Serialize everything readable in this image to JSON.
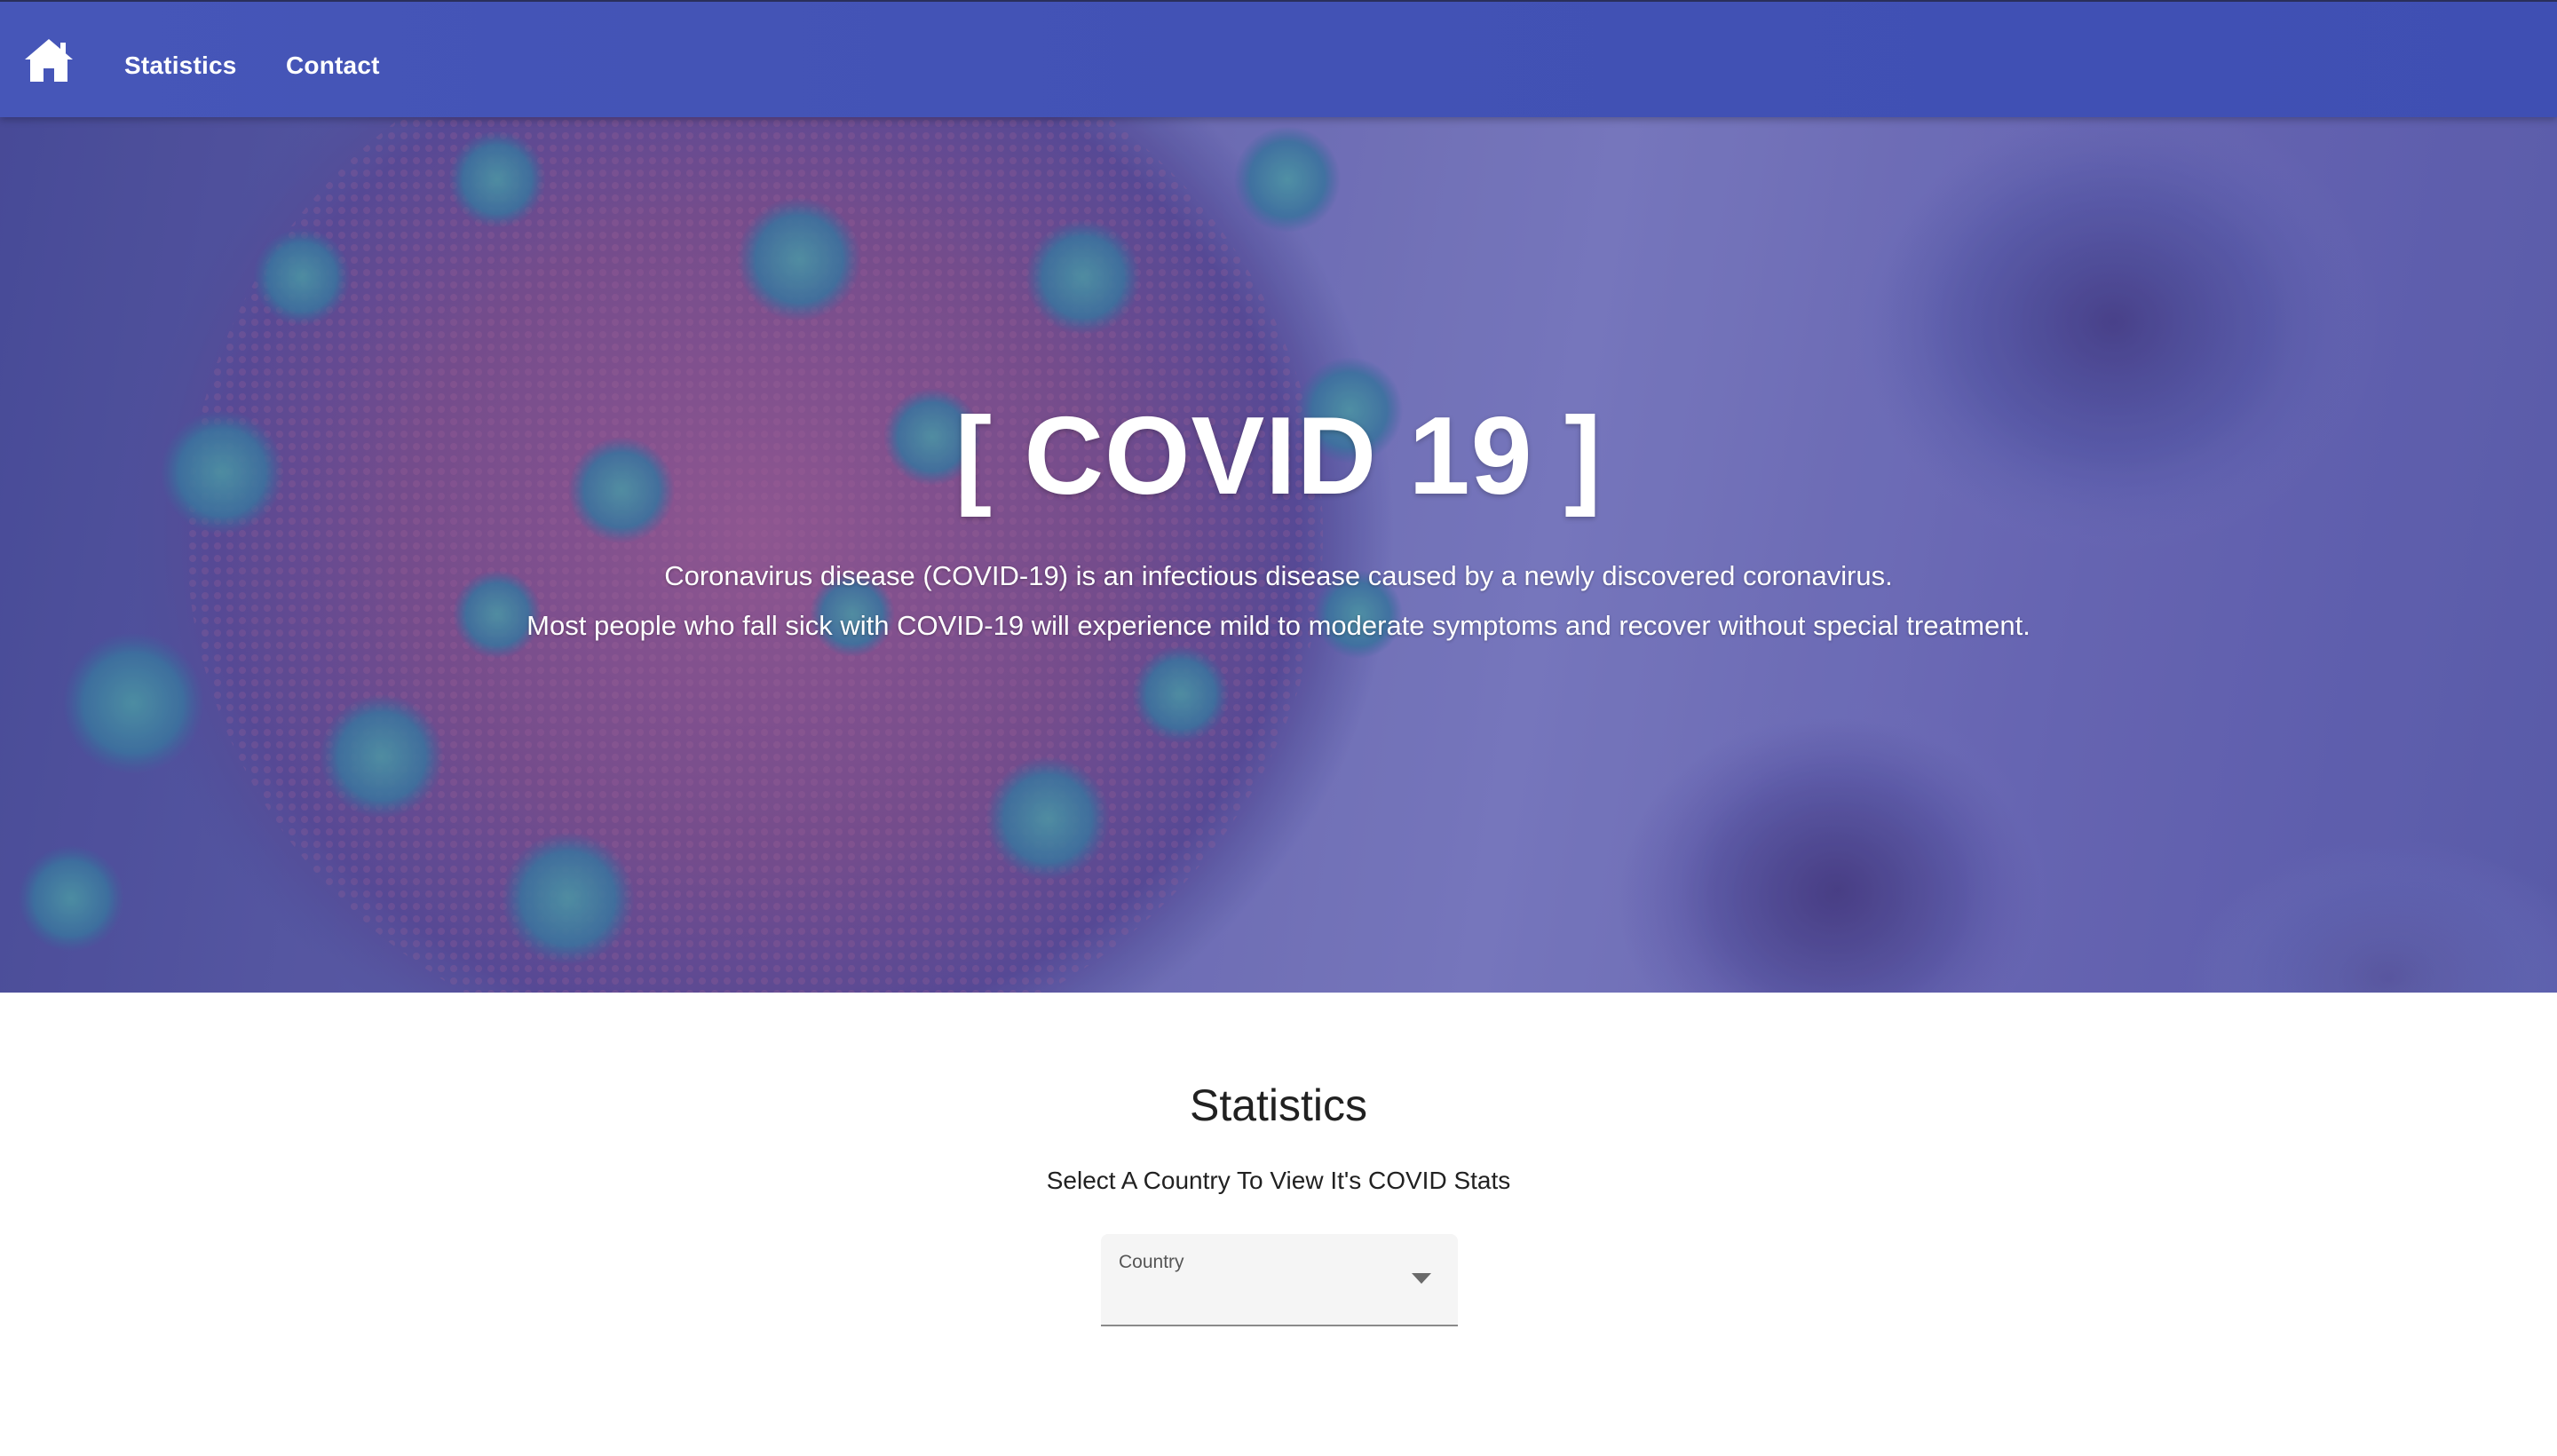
{
  "nav": {
    "home_icon": "home-icon",
    "links": [
      {
        "label": "Statistics"
      },
      {
        "label": "Contact"
      }
    ]
  },
  "hero": {
    "title": "[ COVID 19 ]",
    "description_lines": [
      "Coronavirus disease (COVID-19) is an infectious disease caused by a newly discovered coronavirus.",
      "Most people who fall sick with COVID-19 will experience mild to moderate symptoms and recover without special treatment."
    ],
    "background": "coronavirus particle illustration"
  },
  "statistics": {
    "title": "Statistics",
    "subtitle": "Select A Country To View It's COVID Stats",
    "country_select": {
      "label": "Country",
      "value": "",
      "icon": "chevron-down-icon"
    }
  },
  "colors": {
    "navbar": "#4252b5",
    "hero_overlay": "#6b69b2",
    "text_light": "#ffffff",
    "text_dark": "#212121"
  }
}
